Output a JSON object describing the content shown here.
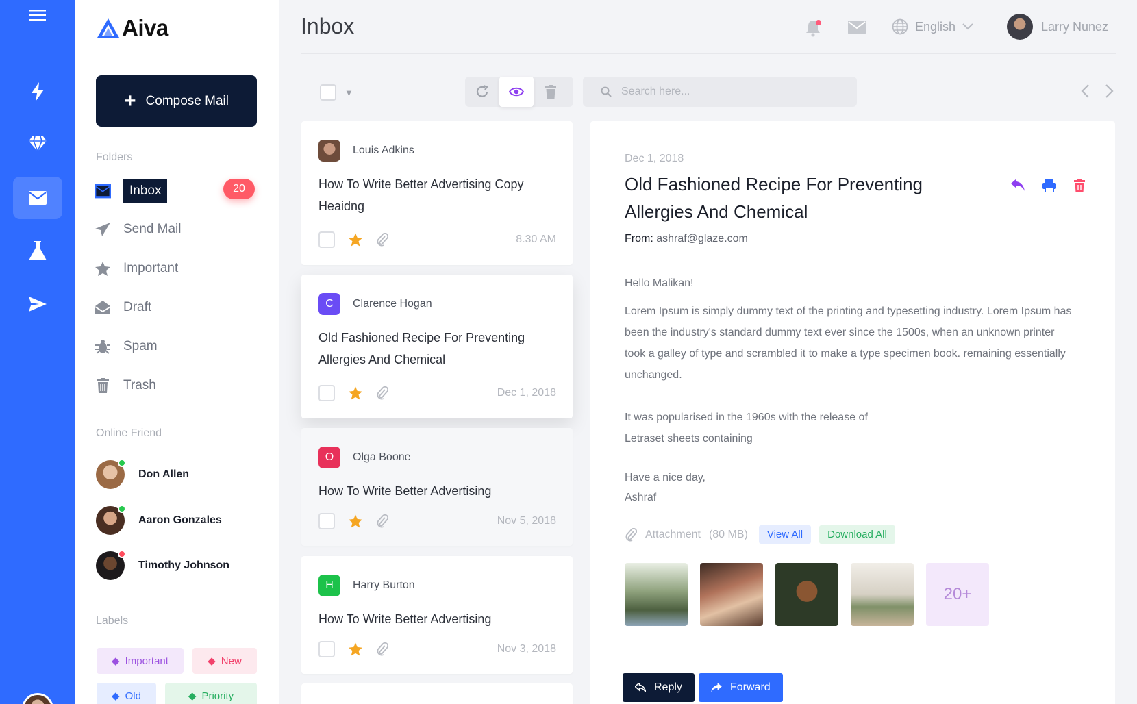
{
  "app": {
    "name": "Aiva"
  },
  "colors": {
    "rail": "#2f6bff",
    "dark": "#0d1b36",
    "badge": "#ff5a66",
    "star": "#f5a623"
  },
  "rail": {
    "icons": [
      "menu-icon",
      "lightning-icon",
      "diamond-icon",
      "mail-icon",
      "flask-icon",
      "send-icon"
    ]
  },
  "sidebar": {
    "compose_label": "Compose Mail",
    "folders_title": "Folders",
    "folders": [
      {
        "label": "Inbox",
        "icon": "inbox-icon",
        "count": "20"
      },
      {
        "label": "Send Mail",
        "icon": "paper-plane-icon"
      },
      {
        "label": "Important",
        "icon": "star-icon"
      },
      {
        "label": "Draft",
        "icon": "envelope-open-icon"
      },
      {
        "label": "Spam",
        "icon": "bug-icon"
      },
      {
        "label": "Trash",
        "icon": "trash-icon"
      }
    ],
    "friends_title": "Online Friend",
    "friends": [
      {
        "name": "Don Allen",
        "status": "online"
      },
      {
        "name": "Aaron Gonzales",
        "status": "online"
      },
      {
        "name": "Timothy Johnson",
        "status": "busy"
      }
    ],
    "labels_title": "Labels",
    "labels": [
      {
        "label": "Important",
        "color": "#9b51e0",
        "bg": "#f3e8fb"
      },
      {
        "label": "New",
        "color": "#f2416b",
        "bg": "#fde9ee"
      },
      {
        "label": "Old",
        "color": "#2f6bff",
        "bg": "#e6edff"
      },
      {
        "label": "Priority",
        "color": "#27ae60",
        "bg": "#e4f6ea"
      }
    ]
  },
  "header": {
    "title": "Inbox",
    "language": "English",
    "user_name": "Larry Nunez"
  },
  "toolbar": {
    "search_placeholder": "Search here..."
  },
  "mails": [
    {
      "sender": "Louis Adkins",
      "avatar": "",
      "avatar_color": "",
      "subject": "How To Write Better Advertising Copy  Heaidng",
      "time": "8.30 AM"
    },
    {
      "sender": "Clarence Hogan",
      "avatar": "C",
      "avatar_color": "#6a4cf5",
      "subject": "Old Fashioned Recipe For Preventing Allergies And Chemical",
      "time": "Dec 1, 2018"
    },
    {
      "sender": "Olga Boone",
      "avatar": "O",
      "avatar_color": "#e8315a",
      "subject": "How To Write Better Advertising",
      "time": "Nov 5, 2018"
    },
    {
      "sender": "Harry Burton",
      "avatar": "H",
      "avatar_color": "#1cc24a",
      "subject": "How To Write Better Advertising",
      "time": "Nov 3, 2018"
    }
  ],
  "detail": {
    "date": "Dec 1, 2018",
    "title": "Old Fashioned Recipe For Preventing Allergies And Chemical",
    "from_label": "From:",
    "from_email": "ashraf@glaze.com",
    "greeting": "Hello Malikan!",
    "paragraph1": "Lorem Ipsum is simply dummy text of the printing and typesetting industry. Lorem Ipsum has been the industry's standard dummy text ever since the 1500s, when an unknown printer took a galley of type and scrambled it to make a type specimen book. remaining essentially unchanged.",
    "paragraph2": "It was popularised in the 1960s with the release of Letraset sheets containing",
    "signoff": "Have a nice day,",
    "signature": "Ashraf",
    "attachment_label": "Attachment",
    "attachment_size": "(80 MB)",
    "view_all": "View All",
    "download_all": "Download All",
    "more_count": "20+",
    "reply_label": "Reply",
    "forward_label": "Forward"
  }
}
